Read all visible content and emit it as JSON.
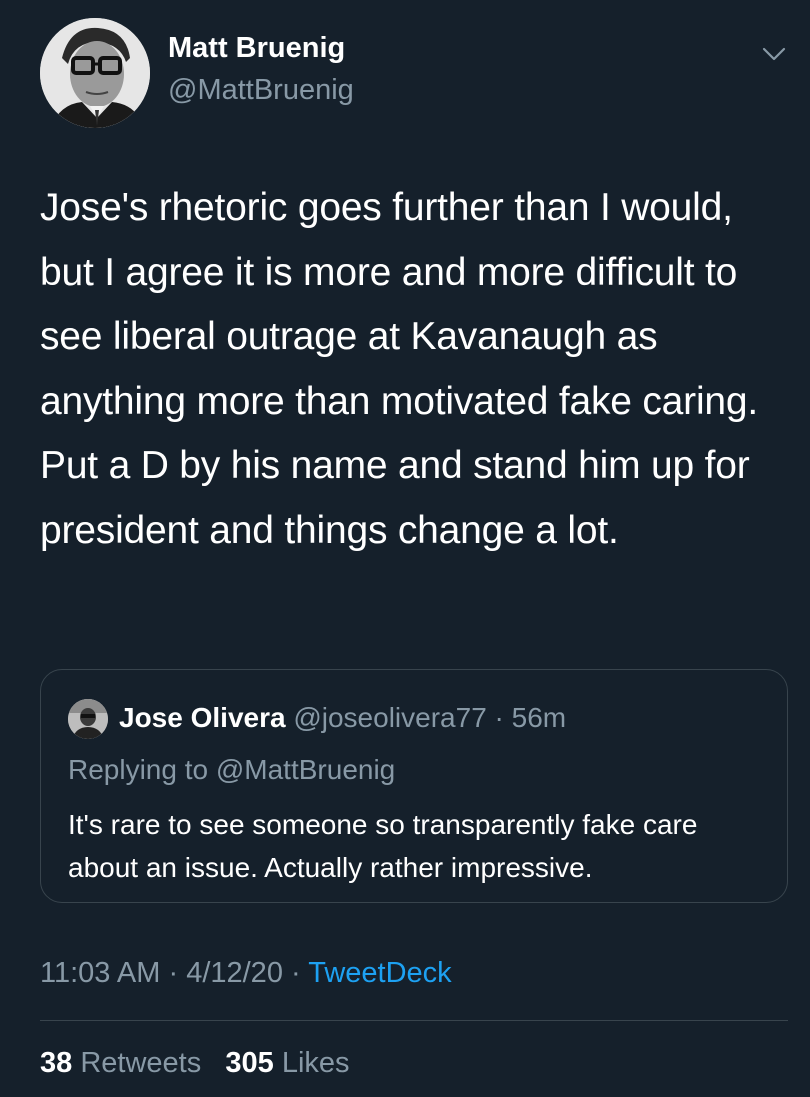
{
  "author": {
    "display_name": "Matt Bruenig",
    "handle": "@MattBruenig"
  },
  "icons": {
    "avatar": "profile-photo-icon",
    "menu": "chevron-down-icon",
    "quoted_avatar": "profile-photo-icon"
  },
  "tweet": {
    "text": "Jose's rhetoric goes further than I would, but I agree it is more and more difficult to see liberal outrage at Kavanaugh as anything more than motivated fake caring. Put a D by his name and stand him up for president and things change a lot."
  },
  "quoted_tweet": {
    "display_name": "Jose Olivera",
    "handle": "@joseolivera77",
    "separator": "·",
    "time": "56m",
    "replying_to": "Replying to @MattBruenig",
    "text": "It's rare to see someone so transparently fake care about an issue. Actually rather impressive."
  },
  "meta": {
    "time": "11:03 AM",
    "date": "4/12/20",
    "separator": "·",
    "source": "TweetDeck"
  },
  "stats": {
    "retweets_count": "38",
    "retweets_label": "Retweets",
    "likes_count": "305",
    "likes_label": "Likes"
  },
  "colors": {
    "background": "#15202b",
    "text_primary": "#ffffff",
    "text_secondary": "#8899a6",
    "link": "#1da1f2",
    "border": "#38444d"
  }
}
